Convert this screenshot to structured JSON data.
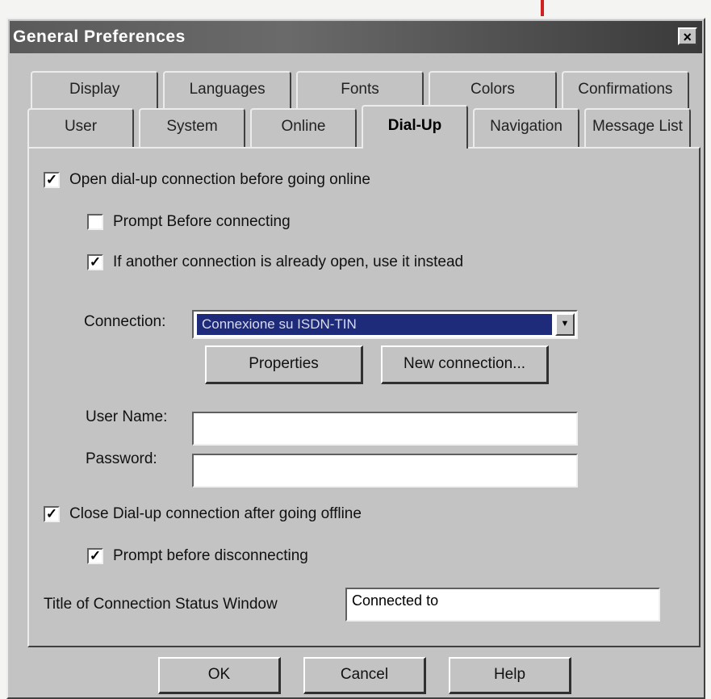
{
  "window": {
    "title": "General Preferences",
    "close_glyph": "×"
  },
  "tabs": {
    "back_row": [
      "Display",
      "Languages",
      "Fonts",
      "Colors",
      "Confirmations"
    ],
    "front_row": [
      "User",
      "System",
      "Online",
      "Dial-Up",
      "Navigation",
      "Message List"
    ],
    "active": "Dial-Up"
  },
  "dialup": {
    "open_before_online": {
      "label": "Open dial-up connection before going online",
      "checked": true
    },
    "prompt_before_connecting": {
      "label": "Prompt Before connecting",
      "checked": false
    },
    "use_existing": {
      "label": "If another connection is already open, use it instead",
      "checked": true
    },
    "connection": {
      "label": "Connection:",
      "value": "Connexione su ISDN-TIN"
    },
    "properties_button": "Properties",
    "new_connection_button": "New connection...",
    "user_name": {
      "label": "User Name:",
      "value": ""
    },
    "password": {
      "label": "Password:",
      "value": ""
    },
    "close_after_offline": {
      "label": "Close Dial-up connection after going offline",
      "checked": true
    },
    "prompt_before_disconnecting": {
      "label": "Prompt before disconnecting",
      "checked": true
    },
    "status_window_title": {
      "label": "Title of Connection Status Window",
      "value": "Connected to"
    }
  },
  "footer": {
    "ok": "OK",
    "cancel": "Cancel",
    "help": "Help"
  },
  "check_glyph": "✓"
}
